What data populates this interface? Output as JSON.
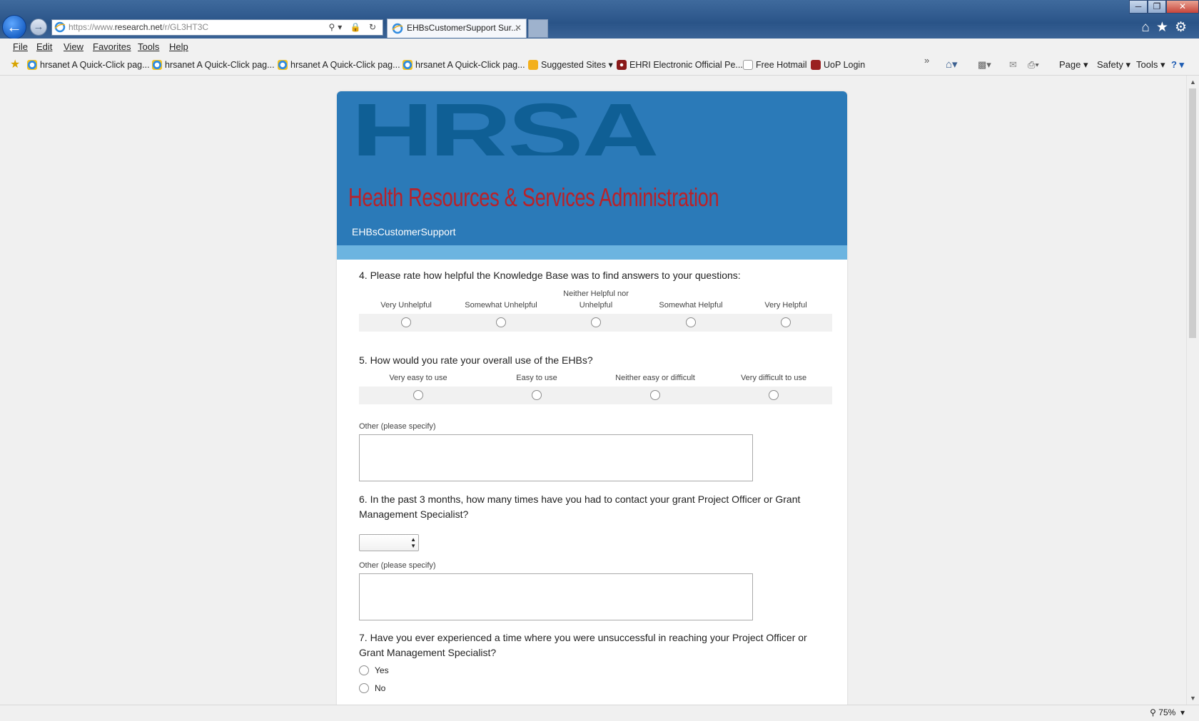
{
  "browser": {
    "url_prefix": "https://www.",
    "url_domain": "research.net",
    "url_path": "/r/GL3HT3C",
    "tab_title": "EHBsCustomerSupport Sur...",
    "tab_close": "✕",
    "menu": [
      "File",
      "Edit",
      "View",
      "Favorites",
      "Tools",
      "Help"
    ],
    "favorites": [
      "hrsanet A Quick-Click pag...",
      "hrsanet A Quick-Click pag...",
      "hrsanet A Quick-Click pag...",
      "hrsanet A Quick-Click pag...",
      "Suggested Sites ▾",
      "EHRI Electronic Official Pe...",
      "Free Hotmail",
      "UoP Login"
    ],
    "overflow": "»",
    "commands": {
      "page": "Page ▾",
      "safety": "Safety ▾",
      "tools": "Tools ▾",
      "help": "? ▾"
    },
    "zoom": "75%"
  },
  "survey": {
    "logo": "HRSA",
    "logo_subtitle": "Health Resources & Services Administration",
    "name": "EHBsCustomerSupport",
    "q4": {
      "text": "4. Please rate how helpful the Knowledge Base was to find answers to your questions:",
      "options": [
        "Very Unhelpful",
        "Somewhat Unhelpful",
        "Neither Helpful nor Unhelpful",
        "Somewhat Helpful",
        "Very Helpful"
      ]
    },
    "q5": {
      "text": "5. How would you rate your overall use of the EHBs?",
      "options": [
        "Very easy to use",
        "Easy to use",
        "Neither easy or difficult",
        "Very difficult to use"
      ],
      "other_label": "Other (please specify)"
    },
    "q6": {
      "text": "6. In the past 3 months, how many times have you had to contact your grant Project Officer or Grant Management Specialist?",
      "other_label": "Other (please specify)"
    },
    "q7": {
      "text": "7. Have you ever experienced a time where you were unsuccessful in reaching your Project Officer or Grant Management Specialist?",
      "options": [
        "Yes",
        "No"
      ]
    }
  }
}
